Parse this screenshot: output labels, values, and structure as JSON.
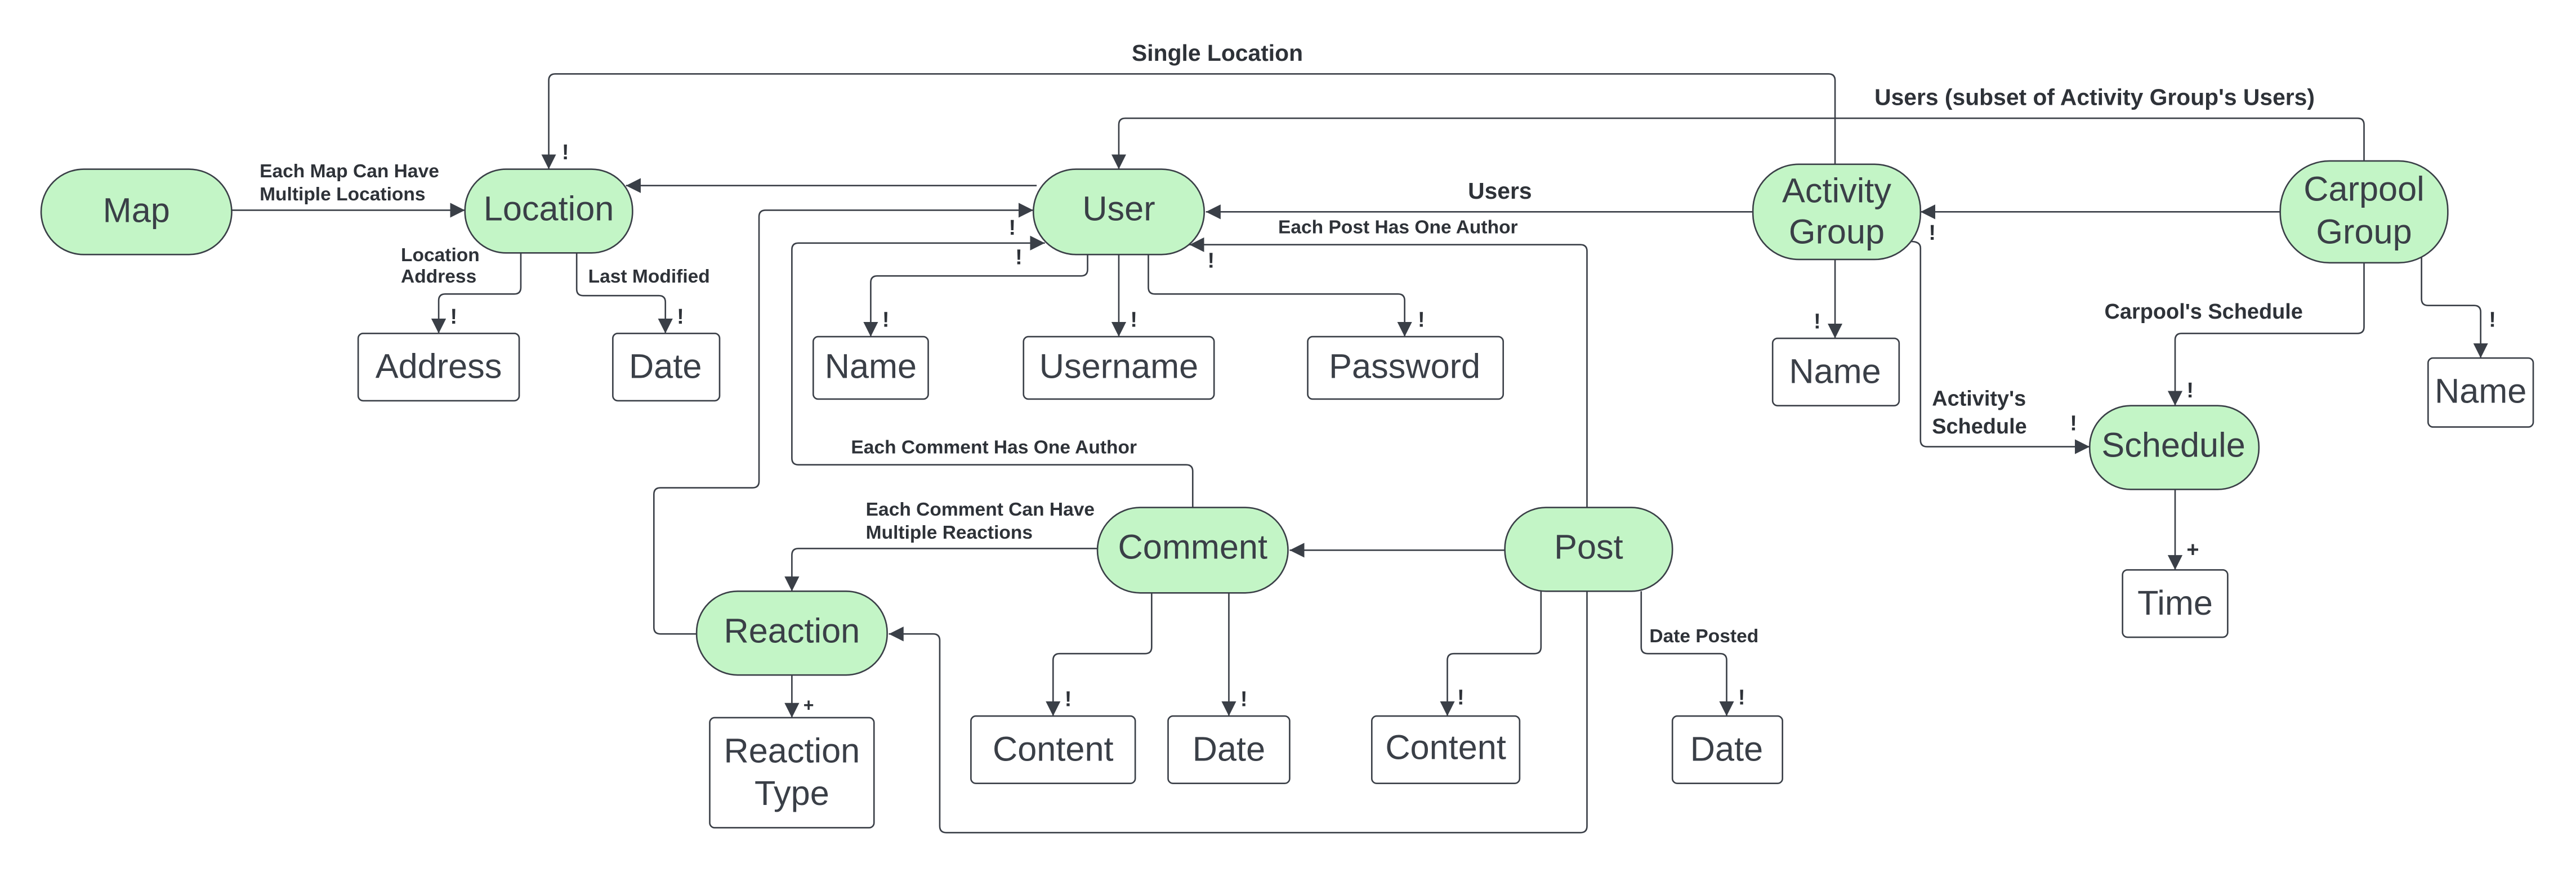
{
  "entities": {
    "map": "Map",
    "location": "Location",
    "user": "User",
    "activity_group": [
      "Activity",
      "Group"
    ],
    "carpool_group": [
      "Carpool",
      "Group"
    ],
    "schedule": "Schedule",
    "comment": "Comment",
    "post": "Post",
    "reaction": "Reaction"
  },
  "attributes": {
    "location_address": "Address",
    "location_date": "Date",
    "user_name": "Name",
    "user_username": "Username",
    "user_password": "Password",
    "activity_name": "Name",
    "carpool_name": "Name",
    "schedule_time": "Time",
    "reaction_type": [
      "Reaction",
      "Type"
    ],
    "comment_content": "Content",
    "comment_date": "Date",
    "post_content": "Content",
    "post_date": "Date"
  },
  "labels": {
    "single_location": "Single Location",
    "users_subset": "Users (subset of Activity Group's Users)",
    "users": "Users",
    "map_locations": [
      "Each Map Can Have",
      "Multiple Locations"
    ],
    "location_address": [
      "Location",
      "Address"
    ],
    "last_modified": "Last Modified",
    "post_author": "Each Post Has One Author",
    "comment_author": "Each Comment Has One Author",
    "comment_reactions": [
      "Each Comment Can Have",
      "Multiple Reactions"
    ],
    "date_posted": "Date Posted",
    "activity_schedule": [
      "Activity's",
      "Schedule"
    ],
    "carpool_schedule": "Carpool's Schedule"
  },
  "cardinality": {
    "required": "!",
    "many": "+"
  },
  "colors": {
    "entity_fill": "#c3f5c6",
    "stroke": "#3a3f47",
    "text": "#3a3f47"
  }
}
